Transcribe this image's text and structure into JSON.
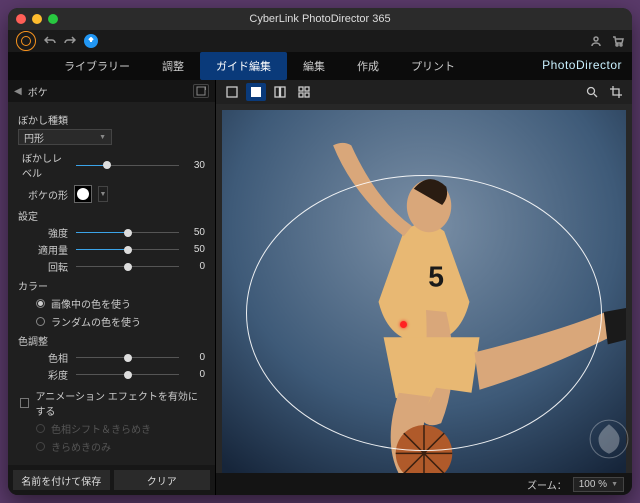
{
  "window": {
    "title": "CyberLink PhotoDirector 365"
  },
  "brand": "PhotoDirector",
  "modules": {
    "library": "ライブラリー",
    "adjust": "調整",
    "guided": "ガイド編集",
    "edit": "編集",
    "create": "作成",
    "print": "プリント"
  },
  "panel": {
    "title": "ボケ",
    "blur_type_label": "ぼかし種類",
    "blur_type_value": "円形",
    "blur_level_label": "ぼかしレベル",
    "blur_level_value": "30",
    "bokeh_shape_label": "ボケの形",
    "settings_label": "設定",
    "intensity_label": "強度",
    "intensity_value": "50",
    "amount_label": "適用量",
    "amount_value": "50",
    "rotate_label": "回転",
    "rotate_value": "0",
    "color_section": "カラー",
    "use_image_color": "画像中の色を使う",
    "use_random_color": "ランダムの色を使う",
    "color_adjust_section": "色調整",
    "hue_label": "色相",
    "hue_value": "0",
    "sat_label": "彩度",
    "sat_value": "0",
    "enable_anim_label": "アニメーション エフェクトを有効にする",
    "anim_shift": "色相シフト＆きらめき",
    "anim_sparkle": "きらめきのみ",
    "save_as_label": "名前を付けて保存",
    "clear_label": "クリア"
  },
  "footer": {
    "zoom_label": "ズーム：",
    "zoom_value": "100 %"
  }
}
